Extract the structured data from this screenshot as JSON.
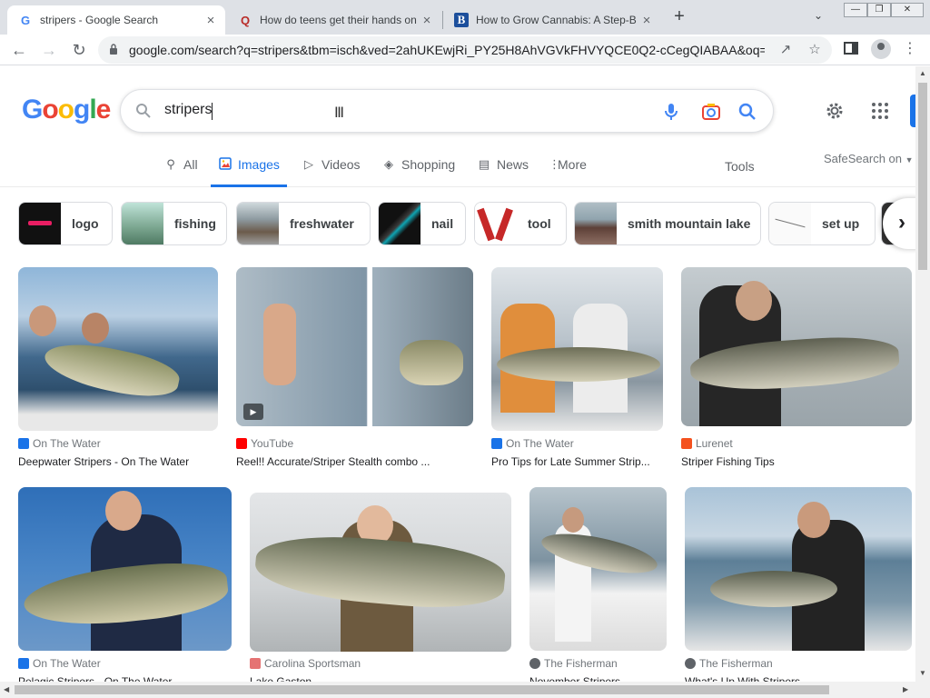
{
  "browser": {
    "tabs": [
      {
        "title": "stripers - Google Search",
        "favicon": "google-g-icon",
        "close": "×"
      },
      {
        "title": "How do teens get their hands on",
        "favicon": "quora-icon",
        "close": "×"
      },
      {
        "title": "How to Grow Cannabis: A Step-B",
        "favicon": "b-icon",
        "close": "×"
      }
    ],
    "new_tab": "+",
    "url": "google.com/search?q=stripers&tbm=isch&ved=2ahUKEwjRi_PY25H8AhVGVkFHVYQCE0Q2-cCegQIABAA&oq=..."
  },
  "search": {
    "logo_letters": [
      "G",
      "o",
      "o",
      "g",
      "l",
      "e"
    ],
    "query": "stripers"
  },
  "tabs": [
    {
      "label": "All",
      "icon": "search-icon"
    },
    {
      "label": "Images",
      "icon": "image-icon"
    },
    {
      "label": "Videos",
      "icon": "video-icon"
    },
    {
      "label": "Shopping",
      "icon": "tag-icon"
    },
    {
      "label": "News",
      "icon": "news-icon"
    },
    {
      "label": "More",
      "icon": "more-vert-icon"
    }
  ],
  "tools": "Tools",
  "safesearch": "SafeSearch on",
  "chips": [
    "logo",
    "fishing",
    "freshwater",
    "nail",
    "tool",
    "smith mountain lake",
    "set up"
  ],
  "results": [
    {
      "source": "On The Water",
      "title": "Deepwater Stripers - On The Water",
      "source_color": "#1a73e8"
    },
    {
      "source": "YouTube",
      "title": "Reel!! Accurate/Striper Stealth combo ...",
      "source_color": "#ff0000"
    },
    {
      "source": "On The Water",
      "title": "Pro Tips for Late Summer Strip...",
      "source_color": "#1a73e8"
    },
    {
      "source": "Lurenet",
      "title": "Striper Fishing Tips",
      "source_color": "#f4511e"
    },
    {
      "source": "On The Water",
      "title": "Pelagic Stripers - On The Water",
      "source_color": "#1a73e8"
    },
    {
      "source": "Carolina Sportsman",
      "title": "Lake Gaston",
      "source_color": "#e57373"
    },
    {
      "source": "The Fisherman",
      "title": "November Stripers",
      "source_color": "#5f6368"
    },
    {
      "source": "The Fisherman",
      "title": "What's Up With Stripers",
      "source_color": "#5f6368"
    }
  ],
  "colors": {
    "accent": "#1a73e8",
    "tab_strip": "#dee1e6"
  }
}
